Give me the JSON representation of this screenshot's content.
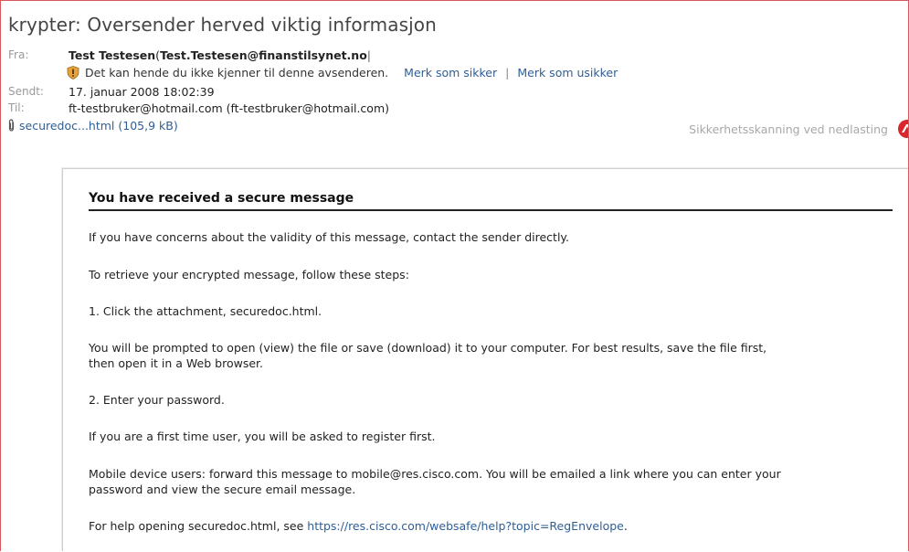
{
  "email": {
    "subject": "krypter: Oversender herved viktig informasjon",
    "from_label": "Fra:",
    "from_name": "Test Testesen",
    "from_paren_open": "(",
    "from_address": "Test.Testesen@finanstilsynet.no",
    "from_paren_close": "|",
    "warning_text": "Det kan hende du ikke kjenner til denne avsenderen.",
    "mark_safe": "Merk som sikker",
    "separator": "|",
    "mark_unsafe": "Merk som usikker",
    "sent_label": "Sendt:",
    "sent_value": "17. januar 2008 18:02:39",
    "to_label": "Til:",
    "to_value": "ft-testbruker@hotmail.com (ft-testbruker@hotmail.com)",
    "attachment_label": "securedoc...html (105,9 kB)",
    "scan_note": "Sikkerhetsskanning ved nedlasting"
  },
  "message": {
    "title": "You have received a secure message",
    "p1": "If you have concerns about the validity of this message, contact the sender directly.",
    "p2": "To retrieve your encrypted message, follow these steps:",
    "p3": "1. Click the attachment, securedoc.html.",
    "p4_line1": "You will be prompted to open (view) the file or save (download) it to your computer. For best results, save the file first,",
    "p4_line2": "then open it in a Web browser.",
    "p5": "2. Enter your password.",
    "p6": "If you are a first time user, you will be asked to register first.",
    "p7_line1": "Mobile device users: forward this message to mobile@res.cisco.com. You will be emailed a link where you can enter your",
    "p7_line2": "password and view the secure email message.",
    "p8_prefix": "For help opening securedoc.html, see ",
    "p8_link": "https://res.cisco.com/websafe/help?topic=RegEnvelope",
    "p8_suffix": "."
  },
  "icons": {
    "shield": "shield-warning-icon",
    "paperclip": "paperclip-icon",
    "scan": "antivirus-scan-icon"
  },
  "colors": {
    "link": "#2f5e96",
    "frame_border": "#d9565c",
    "label_gray": "#9a9a9a",
    "scan_red": "#d8262c"
  }
}
